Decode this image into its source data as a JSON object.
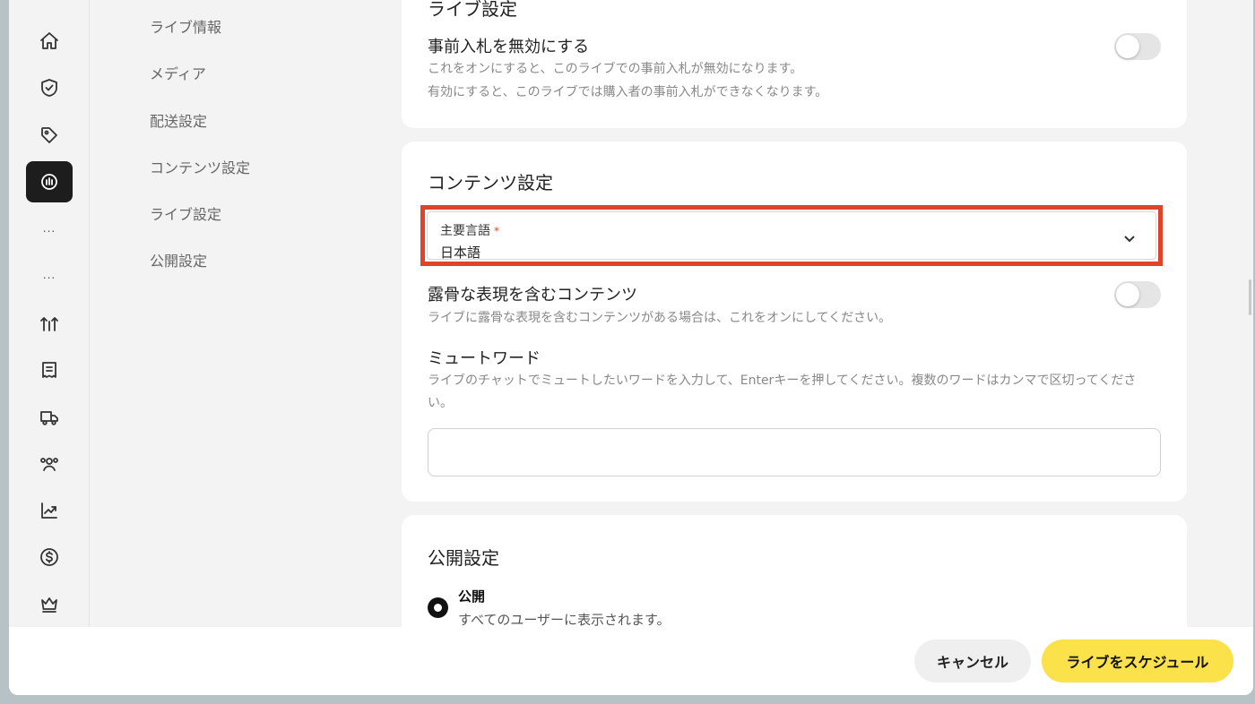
{
  "rail": {
    "dots_1": "...",
    "dots_2": "..."
  },
  "section_nav": {
    "items": [
      "ライブ情報",
      "メディア",
      "配送設定",
      "コンテンツ設定",
      "ライブ設定",
      "公開設定"
    ]
  },
  "live_settings": {
    "title": "ライブ設定",
    "preorder_title": "事前入札を無効にする",
    "preorder_desc_1": "これをオンにすると、このライブでの事前入札が無効になります。",
    "preorder_desc_2": "有効にすると、このライブでは購入者の事前入札ができなくなります。"
  },
  "content_settings": {
    "title": "コンテンツ設定",
    "language_label": "主要言語",
    "language_required": "*",
    "language_value": "日本語",
    "explicit_title": "露骨な表現を含むコンテンツ",
    "explicit_desc": "ライブに露骨な表現を含むコンテンツがある場合は、これをオンにしてください。",
    "mute_title": "ミュートワード",
    "mute_desc": "ライブのチャットでミュートしたいワードを入力して、Enterキーを押してください。複数のワードはカンマで区切ってください。"
  },
  "visibility_settings": {
    "title": "公開設定",
    "public_label": "公開",
    "public_desc": "すべてのユーザーに表示されます。"
  },
  "footer": {
    "cancel_label": "キャンセル",
    "schedule_label": "ライブをスケジュール"
  },
  "colors": {
    "highlight": "#e04428",
    "primary_button": "#fbe14a",
    "active_rail": "#1d1d1d"
  }
}
